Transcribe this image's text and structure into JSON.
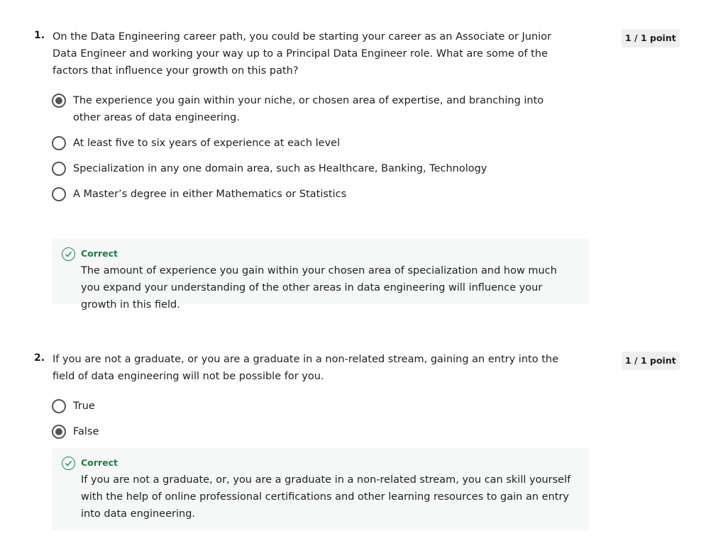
{
  "questions": [
    {
      "number": "1.",
      "text": "On the Data Engineering career path, you could be starting your career as an Associate or Junior Data Engineer and working your way up to a Principal Data Engineer role. What are some of the factors that influence your growth on this path?",
      "points": "1 / 1 point",
      "options": [
        {
          "label": "The experience you gain within your niche, or chosen area of expertise, and branching into other areas of data engineering.",
          "selected": true
        },
        {
          "label": "At least five to six years of experience at each level",
          "selected": false
        },
        {
          "label": "Specialization in any one domain area, such as Healthcare, Banking, Technology",
          "selected": false
        },
        {
          "label": "A Master’s degree in either Mathematics or Statistics",
          "selected": false
        }
      ],
      "feedback": {
        "status": "Correct",
        "text": "The amount of experience you gain within your chosen area of specialization and how much you expand your understanding of the other areas in data engineering will influence your growth in this field."
      }
    },
    {
      "number": "2.",
      "text": "If you are not a graduate, or you are a graduate in a non-related stream, gaining an entry into the field of data engineering will not be possible for you.",
      "points": "1 / 1 point",
      "options": [
        {
          "label": "True",
          "selected": false
        },
        {
          "label": "False",
          "selected": true
        }
      ],
      "feedback": {
        "status": "Correct",
        "text": "If you are not a graduate, or, you are a graduate in a non-related stream, you can skill yourself with the help of online professional certifications and other learning resources to gain an entry into data engineering."
      }
    }
  ],
  "colors": {
    "correct": "#1e7a48",
    "feedback_bg": "#f5f8f6",
    "badge_bg": "#efefef"
  },
  "icons": {
    "radio": "radio-button-icon",
    "correct": "check-circle-icon"
  }
}
